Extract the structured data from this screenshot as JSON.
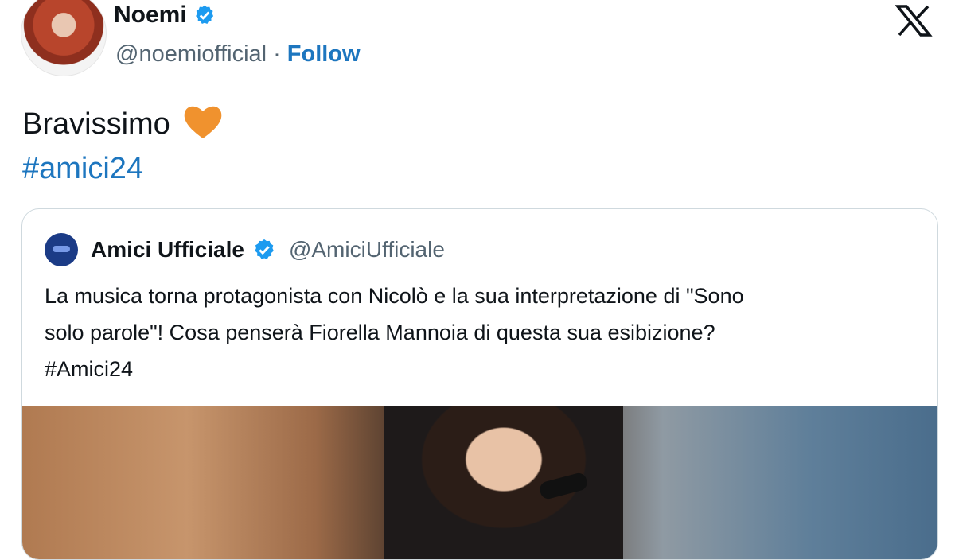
{
  "author": {
    "name": "Noemi",
    "handle": "@noemiofficial",
    "separator": "·",
    "follow_label": "Follow"
  },
  "tweet": {
    "text": "Bravissimo",
    "hashtag": "#amici24"
  },
  "quote": {
    "name": "Amici Ufficiale",
    "handle": "@AmiciUfficiale",
    "lines": [
      "La musica torna protagonista con Nicolò e la sua interpretazione di \"Sono",
      "solo parole\"! Cosa penserà Fiorella Mannoia di questa sua esibizione?",
      "#Amici24"
    ]
  },
  "icons": {
    "logo": "x-logo-icon",
    "verified": "verified-badge-icon",
    "heart": "orange-heart-emoji",
    "heart_color": "#f0922e",
    "verified_color": "#1d9bf0",
    "link_color": "#1d76bf"
  }
}
